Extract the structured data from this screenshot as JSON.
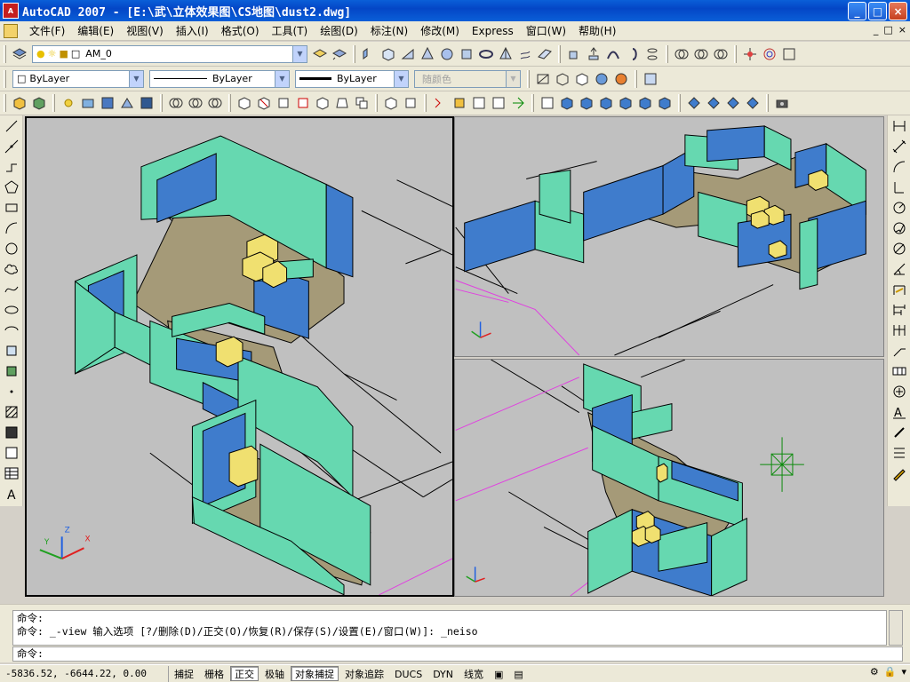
{
  "window": {
    "app_icon": "autocad-logo-icon",
    "title": "AutoCAD 2007 - [E:\\武\\立体效果图\\CS地图\\dust2.dwg]",
    "minimize": "_",
    "restore": "□",
    "close": "×"
  },
  "menubar": {
    "items": [
      "文件(F)",
      "编辑(E)",
      "视图(V)",
      "插入(I)",
      "格式(O)",
      "工具(T)",
      "绘图(D)",
      "标注(N)",
      "修改(M)",
      "Express",
      "窗口(W)",
      "帮助(H)"
    ],
    "doc_minimize": "_",
    "doc_restore": "□",
    "doc_close": "×"
  },
  "layers_toolbar": {
    "layer_value": "AM_0"
  },
  "properties_toolbar": {
    "color_value": "ByLayer",
    "linetype_value": "ByLayer",
    "lineweight_value": "ByLayer",
    "plotstyle_value": "随颜色"
  },
  "command_window": {
    "lines": [
      "命令:",
      "命令: _-view 输入选项 [?/删除(D)/正交(O)/恢复(R)/保存(S)/设置(E)/窗口(W)]: _neiso"
    ],
    "prompt": "命令:"
  },
  "statusbar": {
    "coordinates": "-5836.52, -6644.22, 0.00",
    "buttons": [
      {
        "label": "捕捉",
        "on": false
      },
      {
        "label": "栅格",
        "on": false
      },
      {
        "label": "正交",
        "on": true
      },
      {
        "label": "极轴",
        "on": false
      },
      {
        "label": "对象捕捉",
        "on": true
      },
      {
        "label": "对象追踪",
        "on": false
      },
      {
        "label": "DUCS",
        "on": false
      },
      {
        "label": "DYN",
        "on": false
      },
      {
        "label": "线宽",
        "on": false
      }
    ]
  },
  "colors": {
    "viewport_bg": "#c0c0c0",
    "wall_cyan": "#66d8b0",
    "wall_blue": "#3f7ccc",
    "floor": "#a59a78",
    "crate": "#f0e070",
    "magenta_line": "#e040e0",
    "titlebar": "#0a5fd8"
  }
}
